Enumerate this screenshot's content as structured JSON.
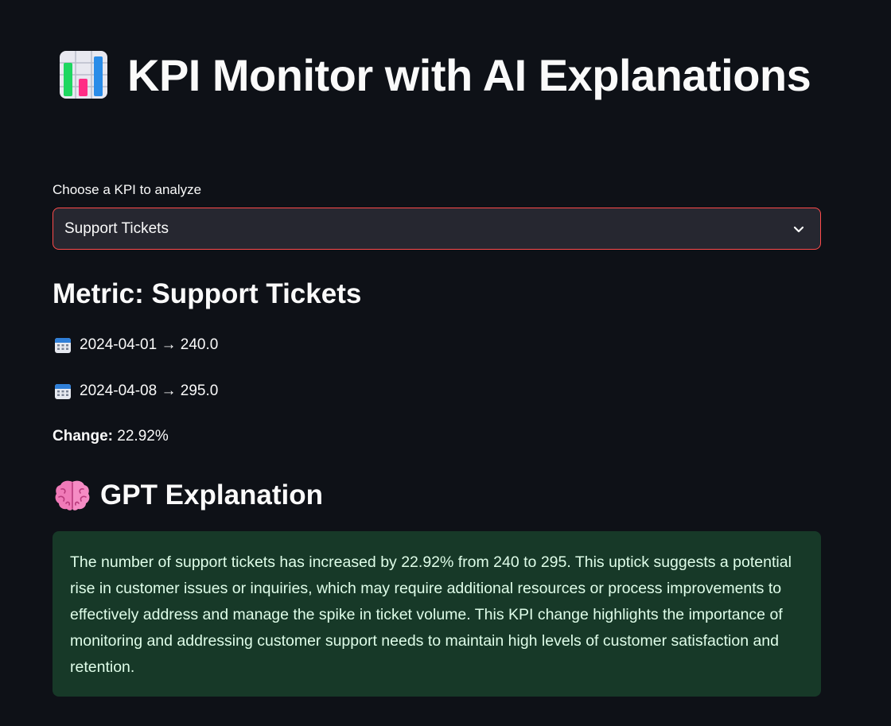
{
  "header": {
    "title": "KPI Monitor with AI Explanations",
    "icon": "bar-chart-emoji-icon"
  },
  "kpi_select": {
    "label": "Choose a KPI to analyze",
    "selected": "Support Tickets",
    "icon": "chevron-down-icon",
    "border_color": "#ff4b4b"
  },
  "metric": {
    "heading": "Metric: Support Tickets",
    "rows": [
      {
        "icon": "calendar-icon",
        "text": "2024-04-01 → 240.0"
      },
      {
        "icon": "calendar-icon",
        "text": "2024-04-08 → 295.0"
      }
    ],
    "change_label": "Change:",
    "change_value": " 22.92%"
  },
  "explanation": {
    "heading": "GPT Explanation",
    "icon": "brain-icon",
    "text": "The number of support tickets has increased by 22.92% from 240 to 295. This uptick suggests a potential rise in customer issues or inquiries, which may require additional resources or process improvements to effectively address and manage the spike in ticket volume. This KPI change highlights the importance of monitoring and addressing customer support needs to maintain high levels of customer satisfaction and retention.",
    "box_color": "#173928",
    "text_color": "#dffde9"
  },
  "theme": {
    "background": "#0e1117",
    "text": "#fafafa",
    "input_background": "#262730"
  }
}
